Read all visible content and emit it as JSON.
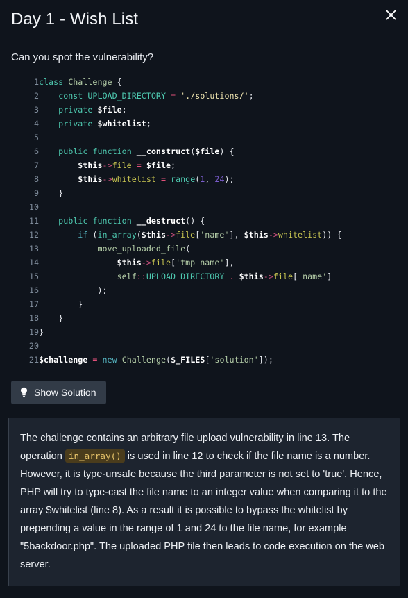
{
  "modal": {
    "title": "Day 1 - Wish List",
    "close_icon": "close-icon",
    "prompt": "Can you spot the vulnerability?"
  },
  "code": {
    "language": "php",
    "lines": [
      {
        "n": "1",
        "tokens": [
          {
            "t": "class",
            "c": "k"
          },
          {
            "t": " ",
            "c": "pn"
          },
          {
            "t": "Challenge",
            "c": "cls"
          },
          {
            "t": " {",
            "c": "pn"
          }
        ]
      },
      {
        "n": "2",
        "tokens": [
          {
            "t": "    ",
            "c": "pn"
          },
          {
            "t": "const",
            "c": "k"
          },
          {
            "t": " ",
            "c": "pn"
          },
          {
            "t": "UPLOAD_DIRECTORY",
            "c": "bfn"
          },
          {
            "t": " ",
            "c": "pn"
          },
          {
            "t": "=",
            "c": "op"
          },
          {
            "t": " ",
            "c": "pn"
          },
          {
            "t": "'./solutions/'",
            "c": "str2"
          },
          {
            "t": ";",
            "c": "pn"
          }
        ]
      },
      {
        "n": "3",
        "tokens": [
          {
            "t": "    ",
            "c": "pn"
          },
          {
            "t": "private",
            "c": "k"
          },
          {
            "t": " ",
            "c": "pn"
          },
          {
            "t": "$file",
            "c": "var"
          },
          {
            "t": ";",
            "c": "pn"
          }
        ]
      },
      {
        "n": "4",
        "tokens": [
          {
            "t": "    ",
            "c": "pn"
          },
          {
            "t": "private",
            "c": "k"
          },
          {
            "t": " ",
            "c": "pn"
          },
          {
            "t": "$whitelist",
            "c": "var"
          },
          {
            "t": ";",
            "c": "pn"
          }
        ]
      },
      {
        "n": "5",
        "tokens": []
      },
      {
        "n": "6",
        "tokens": [
          {
            "t": "    ",
            "c": "pn"
          },
          {
            "t": "public",
            "c": "k"
          },
          {
            "t": " ",
            "c": "pn"
          },
          {
            "t": "function",
            "c": "k"
          },
          {
            "t": " ",
            "c": "pn"
          },
          {
            "t": "__construct",
            "c": "var"
          },
          {
            "t": "(",
            "c": "pn"
          },
          {
            "t": "$file",
            "c": "var"
          },
          {
            "t": ") {",
            "c": "pn"
          }
        ]
      },
      {
        "n": "7",
        "tokens": [
          {
            "t": "        ",
            "c": "pn"
          },
          {
            "t": "$this",
            "c": "var"
          },
          {
            "t": "->",
            "c": "arrow"
          },
          {
            "t": "file",
            "c": "prop"
          },
          {
            "t": " ",
            "c": "pn"
          },
          {
            "t": "=",
            "c": "op"
          },
          {
            "t": " ",
            "c": "pn"
          },
          {
            "t": "$file",
            "c": "var"
          },
          {
            "t": ";",
            "c": "pn"
          }
        ]
      },
      {
        "n": "8",
        "tokens": [
          {
            "t": "        ",
            "c": "pn"
          },
          {
            "t": "$this",
            "c": "var"
          },
          {
            "t": "->",
            "c": "arrow"
          },
          {
            "t": "whitelist",
            "c": "prop"
          },
          {
            "t": " ",
            "c": "pn"
          },
          {
            "t": "=",
            "c": "op"
          },
          {
            "t": " ",
            "c": "pn"
          },
          {
            "t": "range",
            "c": "bfn"
          },
          {
            "t": "(",
            "c": "pn"
          },
          {
            "t": "1",
            "c": "num"
          },
          {
            "t": ", ",
            "c": "pn"
          },
          {
            "t": "24",
            "c": "num"
          },
          {
            "t": ");",
            "c": "pn"
          }
        ]
      },
      {
        "n": "9",
        "tokens": [
          {
            "t": "    }",
            "c": "pn"
          }
        ]
      },
      {
        "n": "10",
        "tokens": []
      },
      {
        "n": "11",
        "tokens": [
          {
            "t": "    ",
            "c": "pn"
          },
          {
            "t": "public",
            "c": "k"
          },
          {
            "t": " ",
            "c": "pn"
          },
          {
            "t": "function",
            "c": "k"
          },
          {
            "t": " ",
            "c": "pn"
          },
          {
            "t": "__destruct",
            "c": "var"
          },
          {
            "t": "() {",
            "c": "pn"
          }
        ]
      },
      {
        "n": "12",
        "tokens": [
          {
            "t": "        ",
            "c": "pn"
          },
          {
            "t": "if",
            "c": "kc"
          },
          {
            "t": " (",
            "c": "pn"
          },
          {
            "t": "in_array",
            "c": "bfn"
          },
          {
            "t": "(",
            "c": "pn"
          },
          {
            "t": "$this",
            "c": "var"
          },
          {
            "t": "->",
            "c": "arrow"
          },
          {
            "t": "file",
            "c": "prop"
          },
          {
            "t": "[",
            "c": "pn"
          },
          {
            "t": "'name'",
            "c": "str"
          },
          {
            "t": "], ",
            "c": "pn"
          },
          {
            "t": "$this",
            "c": "var"
          },
          {
            "t": "->",
            "c": "arrow"
          },
          {
            "t": "whitelist",
            "c": "prop"
          },
          {
            "t": ")) {",
            "c": "pn"
          }
        ]
      },
      {
        "n": "13",
        "tokens": [
          {
            "t": "            ",
            "c": "pn"
          },
          {
            "t": "move_uploaded_file",
            "c": "fn"
          },
          {
            "t": "(",
            "c": "pn"
          }
        ]
      },
      {
        "n": "14",
        "tokens": [
          {
            "t": "                ",
            "c": "pn"
          },
          {
            "t": "$this",
            "c": "var"
          },
          {
            "t": "->",
            "c": "arrow"
          },
          {
            "t": "file",
            "c": "prop"
          },
          {
            "t": "[",
            "c": "pn"
          },
          {
            "t": "'tmp_name'",
            "c": "str"
          },
          {
            "t": "],",
            "c": "pn"
          }
        ]
      },
      {
        "n": "15",
        "tokens": [
          {
            "t": "                ",
            "c": "pn"
          },
          {
            "t": "self",
            "c": "cls"
          },
          {
            "t": "::",
            "c": "op"
          },
          {
            "t": "UPLOAD_DIRECTORY",
            "c": "bfn"
          },
          {
            "t": " ",
            "c": "pn"
          },
          {
            "t": ".",
            "c": "op"
          },
          {
            "t": " ",
            "c": "pn"
          },
          {
            "t": "$this",
            "c": "var"
          },
          {
            "t": "->",
            "c": "arrow"
          },
          {
            "t": "file",
            "c": "prop"
          },
          {
            "t": "[",
            "c": "pn"
          },
          {
            "t": "'name'",
            "c": "str"
          },
          {
            "t": "]",
            "c": "pn"
          }
        ]
      },
      {
        "n": "16",
        "tokens": [
          {
            "t": "            );",
            "c": "pn"
          }
        ]
      },
      {
        "n": "17",
        "tokens": [
          {
            "t": "        }",
            "c": "pn"
          }
        ]
      },
      {
        "n": "18",
        "tokens": [
          {
            "t": "    }",
            "c": "pn"
          }
        ]
      },
      {
        "n": "19",
        "tokens": [
          {
            "t": "}",
            "c": "pn"
          }
        ]
      },
      {
        "n": "20",
        "tokens": []
      },
      {
        "n": "21",
        "tokens": [
          {
            "t": "$challenge",
            "c": "var"
          },
          {
            "t": " ",
            "c": "pn"
          },
          {
            "t": "=",
            "c": "op"
          },
          {
            "t": " ",
            "c": "pn"
          },
          {
            "t": "new",
            "c": "kc"
          },
          {
            "t": " ",
            "c": "pn"
          },
          {
            "t": "Challenge",
            "c": "cls"
          },
          {
            "t": "(",
            "c": "pn"
          },
          {
            "t": "$_FILES",
            "c": "var"
          },
          {
            "t": "[",
            "c": "pn"
          },
          {
            "t": "'solution'",
            "c": "str"
          },
          {
            "t": "]);",
            "c": "pn"
          }
        ]
      }
    ]
  },
  "solution_button": {
    "label": "Show Solution",
    "icon": "lightbulb-icon"
  },
  "solution": {
    "part1": "The challenge contains an arbitrary file upload vulnerability in line 13. The operation ",
    "inline_code": "in_array()",
    "part2": " is used in line 12 to check if the file name is a number. However, it is type-unsafe because the third parameter is not set to 'true'. Hence, PHP will try to type-cast the file name to an integer value when comparing it to the array $whitelist (line 8). As a result it is possible to bypass the whitelist by prepending a value in the range of 1 and 24 to the file name, for example \"5backdoor.php\". The uploaded PHP file then leads to code execution on the web server."
  },
  "colors": {
    "page_bg": "#0f141c",
    "panel_bg": "#1d242f",
    "button_bg": "#323b47",
    "inline_code_bg": "#4a3c1c",
    "inline_code_fg": "#e8c46a"
  }
}
